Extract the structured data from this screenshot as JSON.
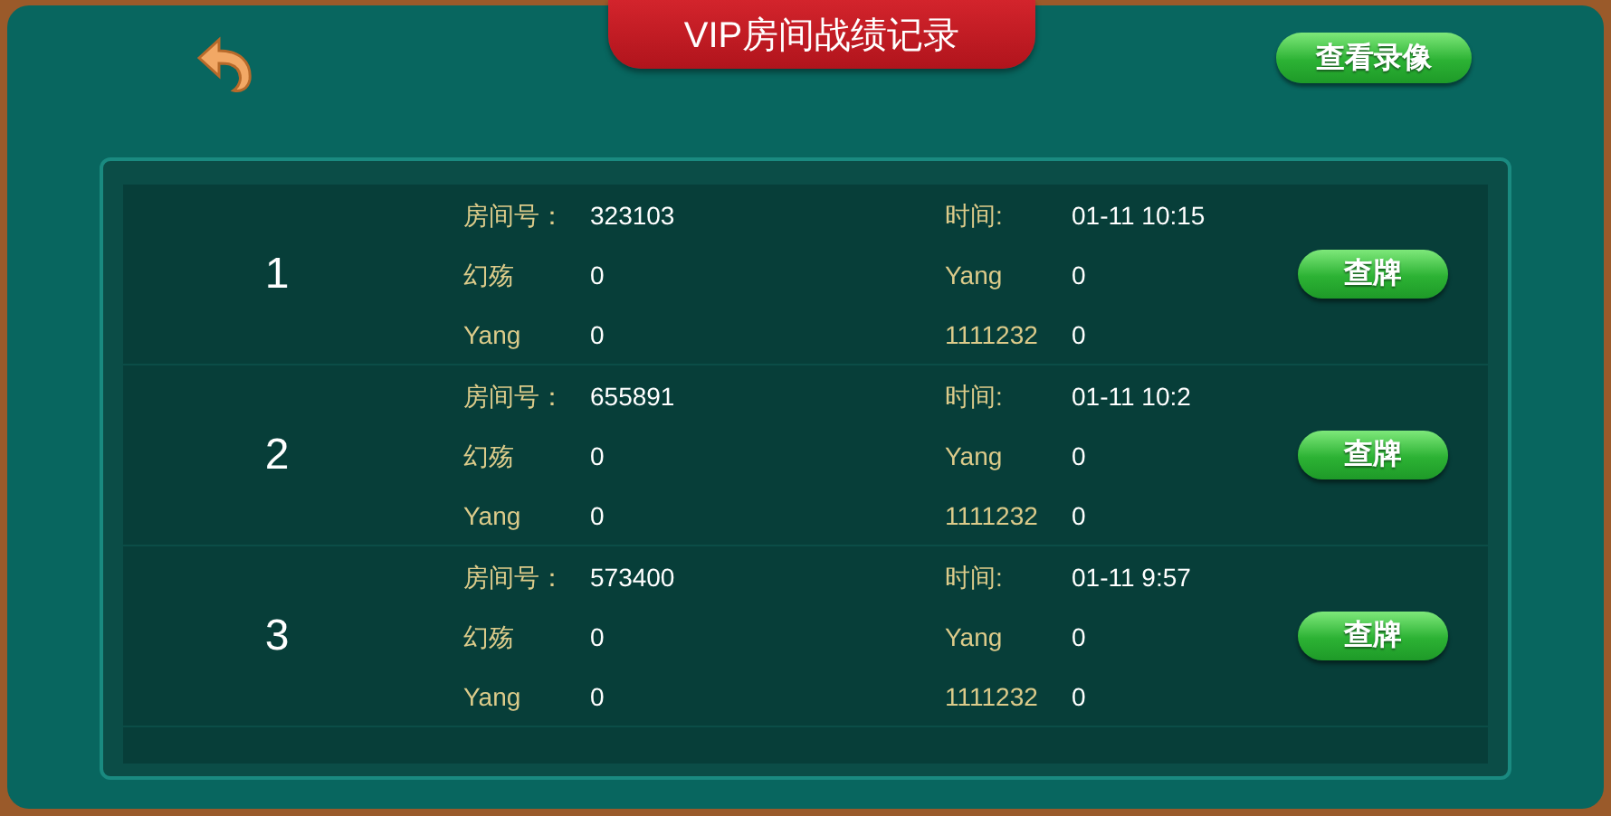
{
  "header": {
    "title": "VIP房间战绩记录",
    "replay_button": "查看录像"
  },
  "records": [
    {
      "index": "1",
      "room_label": "房间号：",
      "room": "323103",
      "time_label": "时间:",
      "time": "01-11  10:15",
      "players": [
        {
          "name": "幻殇",
          "score": "0"
        },
        {
          "name": "Yang",
          "score": "0"
        },
        {
          "name": "Yang",
          "score": "0"
        },
        {
          "name": "1111232",
          "score": "0"
        }
      ],
      "button": "查牌"
    },
    {
      "index": "2",
      "room_label": "房间号：",
      "room": "655891",
      "time_label": "时间:",
      "time": "01-11  10:2",
      "players": [
        {
          "name": "幻殇",
          "score": "0"
        },
        {
          "name": "Yang",
          "score": "0"
        },
        {
          "name": "Yang",
          "score": "0"
        },
        {
          "name": "1111232",
          "score": "0"
        }
      ],
      "button": "查牌"
    },
    {
      "index": "3",
      "room_label": "房间号：",
      "room": "573400",
      "time_label": "时间:",
      "time": "01-11  9:57",
      "players": [
        {
          "name": "幻殇",
          "score": "0"
        },
        {
          "name": "Yang",
          "score": "0"
        },
        {
          "name": "Yang",
          "score": "0"
        },
        {
          "name": "1111232",
          "score": "0"
        }
      ],
      "button": "查牌"
    }
  ]
}
